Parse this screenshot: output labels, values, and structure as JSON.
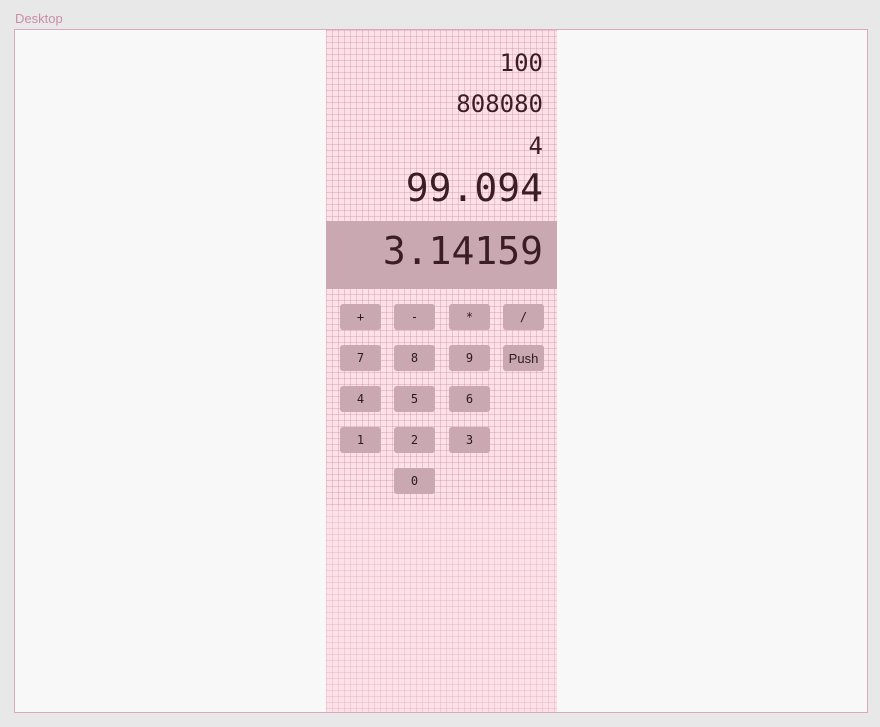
{
  "frame": {
    "label": "Desktop"
  },
  "calculator": {
    "stack": [
      "100",
      "808080",
      "4",
      "99.094"
    ],
    "current": "3.14159",
    "keys": {
      "plus": "+",
      "minus": "-",
      "times": "*",
      "divide": "/",
      "k7": "7",
      "k8": "8",
      "k9": "9",
      "push": "Push",
      "k4": "4",
      "k5": "5",
      "k6": "6",
      "k1": "1",
      "k2": "2",
      "k3": "3",
      "k0": "0"
    }
  },
  "colors": {
    "column_bg": "#fde1e9",
    "current_bg": "#c9a8b1",
    "key_bg": "#c9a8b1",
    "text": "#3a1d26",
    "frame_border": "#d9a9be",
    "frame_label": "#c88ea6"
  }
}
